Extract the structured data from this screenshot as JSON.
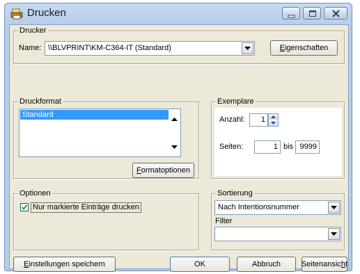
{
  "window": {
    "title": "Drucken",
    "icon": "printer-app-icon",
    "controls": [
      "minimize-icon",
      "maximize-icon",
      "close-icon"
    ]
  },
  "printer_group": {
    "legend": "Drucker",
    "name_label": "Name:",
    "name_value": "\\\\BLVPRINT\\KM-C364-IT (Standard)",
    "properties_button": "Eigenschaften"
  },
  "format_group": {
    "legend": "Druckformat",
    "items": [
      "Standard"
    ],
    "selected_index": 0,
    "options_button": "Formatoptionen"
  },
  "copies_group": {
    "legend": "Exemplare",
    "count_label": "Anzahl:",
    "count_value": "1",
    "pages_label": "Seiten:",
    "pages_from": "1",
    "pages_to_label": "bis",
    "pages_to": "9999"
  },
  "options_group": {
    "legend": "Optionen",
    "only_marked_label": "Nur markierte Einträge drucken",
    "only_marked_checked": true
  },
  "sorting_group": {
    "legend": "Sortierung",
    "sort_value": "Nach Intentionsnummer",
    "filter_label": "Filter",
    "filter_value": ""
  },
  "footer": {
    "save_settings": "Einstellungen speichern",
    "ok": "OK",
    "cancel": "Abbruch",
    "preview": "Seitenansicht"
  },
  "colors": {
    "selection": "#3399ff",
    "dialog_face": "#ece9d8",
    "titlebar": "#b7cdea"
  }
}
